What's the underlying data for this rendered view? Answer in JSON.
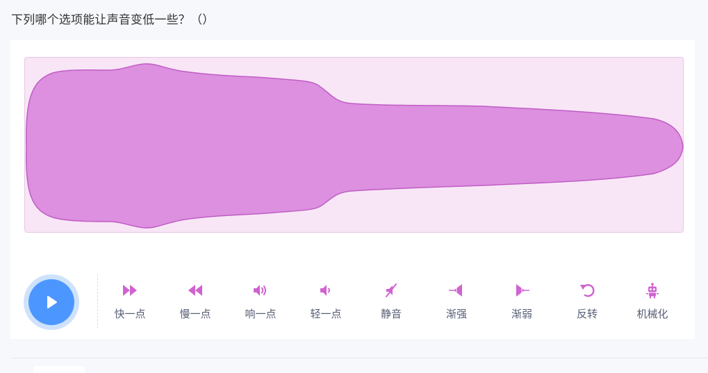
{
  "question": {
    "text": "下列哪个选项能让声音变低一些？（）"
  },
  "colors": {
    "wave_fill": "#dc90df",
    "wave_stroke": "#c05cc6",
    "wave_bg": "#f8e6f6",
    "play_button": "#4c97ff",
    "play_ring": "#cfe2fb",
    "icon": "#cf63cf",
    "label": "#575e75"
  },
  "player": {
    "play_icon": "play-icon"
  },
  "effects": [
    {
      "icon": "faster-icon",
      "label": "快一点"
    },
    {
      "icon": "slower-icon",
      "label": "慢一点"
    },
    {
      "icon": "louder-icon",
      "label": "响一点"
    },
    {
      "icon": "softer-icon",
      "label": "轻一点"
    },
    {
      "icon": "mute-icon",
      "label": "静音"
    },
    {
      "icon": "fade-in-icon",
      "label": "渐强"
    },
    {
      "icon": "fade-out-icon",
      "label": "渐弱"
    },
    {
      "icon": "reverse-icon",
      "label": "反转"
    },
    {
      "icon": "robot-icon",
      "label": "机械化"
    }
  ]
}
